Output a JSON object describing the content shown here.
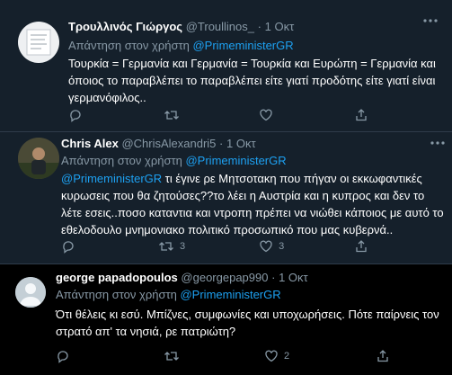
{
  "tweets": [
    {
      "name": "Τρουλλινός Γιώργος",
      "handle": "@Troullinos_",
      "dot": "·",
      "date": "1 Οκτ",
      "reply_prefix": "Απάντηση στον χρήστη",
      "reply_to": "@PrimeministerGR",
      "body_lines": [
        "Τουρκία = Γερμανία και Γερμανία = Τουρκία  και Ευρώπη = Γερμανία και",
        "όποιος το παραβλέπει το παραβλέπει είτε γιατί προδότης είτε γιατί είναι",
        "γερμανόφιλος.."
      ],
      "retweets": "",
      "likes": "",
      "avatar_icon": "avatar-image"
    },
    {
      "name": "Chris Alex",
      "handle": "@ChrisAlexandri5",
      "dot": "·",
      "date": "1 Οκτ",
      "reply_prefix": "Απάντηση στον χρήστη",
      "reply_to": "@PrimeministerGR",
      "body_mention": "@PrimeministerGR",
      "body_lines": [
        " τι έγινε ρε Μητσοτακη που πήγαν οι εκκωφαντικές",
        "κυρωσεις που θα ζητούσες??το λέει η Αυστρία και η κυπρος και δεν το",
        "λέτε εσεις..ποσο καταντια και ντροπη πρέπει να νιώθει κάποιος με αυτό το",
        "εθελοδουλο μνημονιακο πολιτικό προσωπικό που μας κυβερνά.."
      ],
      "retweets": "3",
      "likes": "3",
      "avatar_icon": "avatar-photo"
    },
    {
      "name": "george papadopoulos",
      "handle": "@georgepap990",
      "dot": "·",
      "date": "1 Οκτ",
      "reply_prefix": "Απάντηση στον χρήστη",
      "reply_to": "@PrimeministerGR",
      "body_lines": [
        "Ότι θέλεις κι εσύ. Μπίζνες, συμφωνίες και υποχωρήσεις. Πότε παίρνεις τον",
        "στρατό απ' τα νησιά, ρε πατριώτη?"
      ],
      "retweets": "",
      "likes": "2",
      "avatar_icon": "default-avatar-icon"
    }
  ],
  "colors": {
    "background": "#15202b",
    "last_background": "#000000",
    "link": "#1da1f2",
    "muted": "#8899a6"
  }
}
